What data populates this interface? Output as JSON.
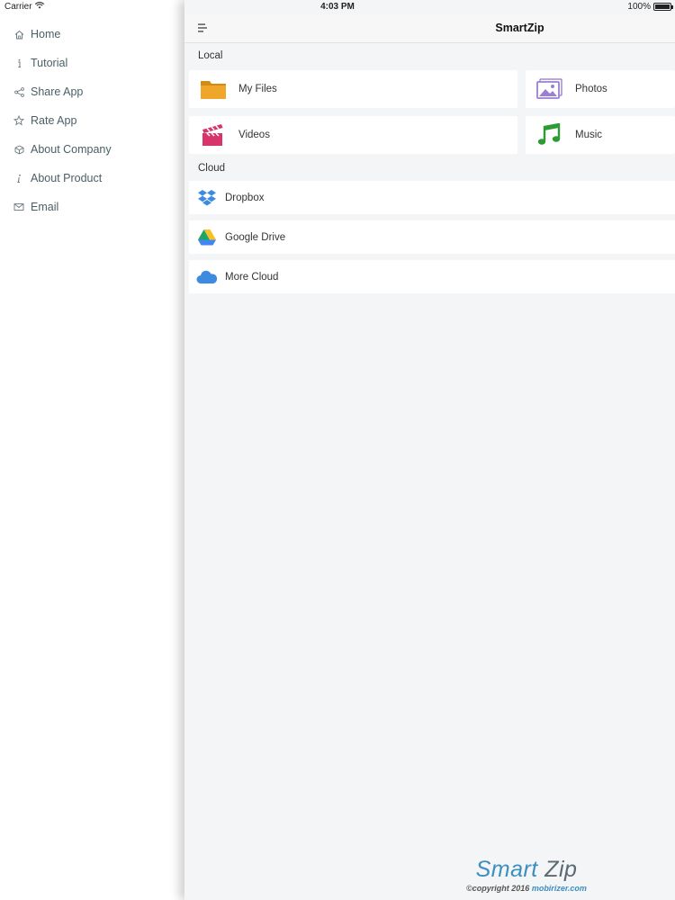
{
  "status_bar": {
    "carrier": "Carrier",
    "time": "4:03 PM",
    "battery": "100%"
  },
  "sidebar": {
    "items": [
      {
        "label": "Home",
        "icon": "home-icon"
      },
      {
        "label": "Tutorial",
        "icon": "info-icon"
      },
      {
        "label": "Share App",
        "icon": "share-icon"
      },
      {
        "label": "Rate App",
        "icon": "star-icon"
      },
      {
        "label": "About Company",
        "icon": "company-icon"
      },
      {
        "label": "About Product",
        "icon": "product-icon"
      },
      {
        "label": "Email",
        "icon": "email-icon"
      }
    ]
  },
  "header": {
    "title": "SmartZip",
    "menu_icon": "hamburger-icon"
  },
  "local": {
    "label": "Local",
    "tiles": [
      {
        "label": "My Files",
        "icon": "folder-icon",
        "color": "#e8a02c"
      },
      {
        "label": "Photos",
        "icon": "photos-icon",
        "color": "#9b7fd4"
      },
      {
        "label": "Videos",
        "icon": "clapperboard-icon",
        "color": "#d8346c"
      },
      {
        "label": "Music",
        "icon": "music-note-icon",
        "color": "#2e9a35"
      }
    ]
  },
  "cloud": {
    "label": "Cloud",
    "rows": [
      {
        "label": "Dropbox",
        "icon": "dropbox-icon",
        "color": "#3d8be0"
      },
      {
        "label": "Google Drive",
        "icon": "google-drive-icon",
        "color": "#1fa463"
      },
      {
        "label": "More Cloud",
        "icon": "cloud-icon",
        "color": "#3d8be0"
      }
    ]
  },
  "footer": {
    "brand_smart": "Smart",
    "brand_zip": "Zip",
    "copyright": "©copyright 2016",
    "site": "mobirizer.com"
  },
  "colors": {
    "accent": "#3b8ec0",
    "sidebar_text": "#4a6066",
    "panel_bg": "#f4f5f7"
  }
}
